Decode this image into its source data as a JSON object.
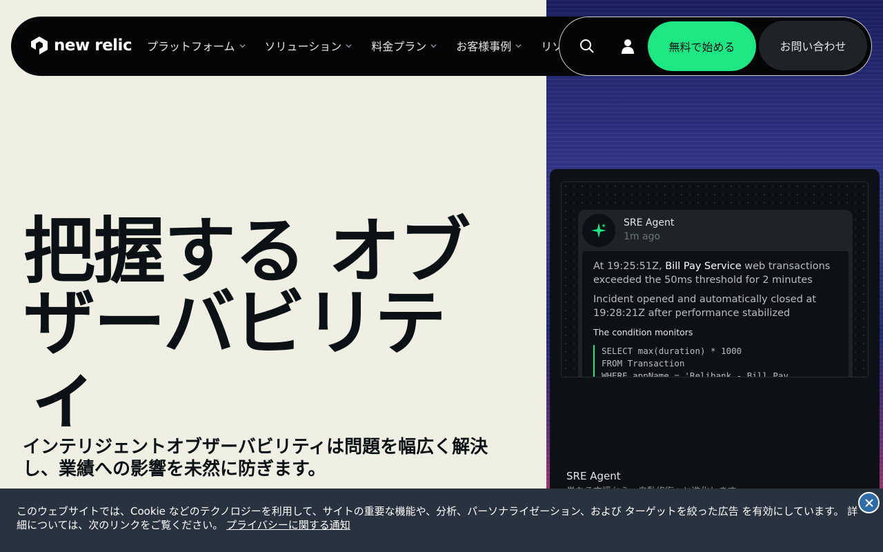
{
  "brand": {
    "name": "new relic"
  },
  "nav": {
    "links": [
      {
        "label": "プラットフォーム"
      },
      {
        "label": "ソリューション"
      },
      {
        "label": "料金プラン"
      },
      {
        "label": "お客様事例"
      },
      {
        "label": "リソース"
      }
    ],
    "start_label": "無料で始める",
    "contact_label": "お問い合わせ"
  },
  "hero": {
    "title_line1": "把握する オブ",
    "title_line2": "ザーバビリテ",
    "title_line3": "ィ",
    "subtitle": "インテリジェントオブザーバビリティは問題を幅広く解決し、業績への影響を未然に防ぎます。"
  },
  "card": {
    "agent_name": "SRE Agent",
    "agent_time": "1m ago",
    "p1_pre": "At 19:25:51Z, ",
    "p1_service": "Bill Pay Service",
    "p1_post": " web transactions exceeded the 50ms threshold for 2 minutes",
    "p2": "Incident opened and automatically closed at 19:28:21Z after performance stabilized",
    "condition_label": "The condition monitors",
    "code_line1": "SELECT max(duration) * 1000",
    "code_line2": "FROM Transaction",
    "code_line3": "WHERE appName = 'Relibank - Bill Pay",
    "footer_title": "SRE Agent",
    "footer_desc": "単なる支援から、自動修復へと進化します"
  },
  "cookie": {
    "text": "このウェブサイトでは、Cookie などのテクノロジーを利用して、サイトの重要な機能や、分析、パーソナライゼーション、および ターゲットを絞った広告 を有効にしています。 詳細については、次のリンクをご覧ください。",
    "link_label": "プライバシーに関する通知"
  },
  "colors": {
    "accent": "#1ce783",
    "nav_bg": "#030506",
    "page_bg": "#f0efe3",
    "banner_bg": "#293340"
  }
}
